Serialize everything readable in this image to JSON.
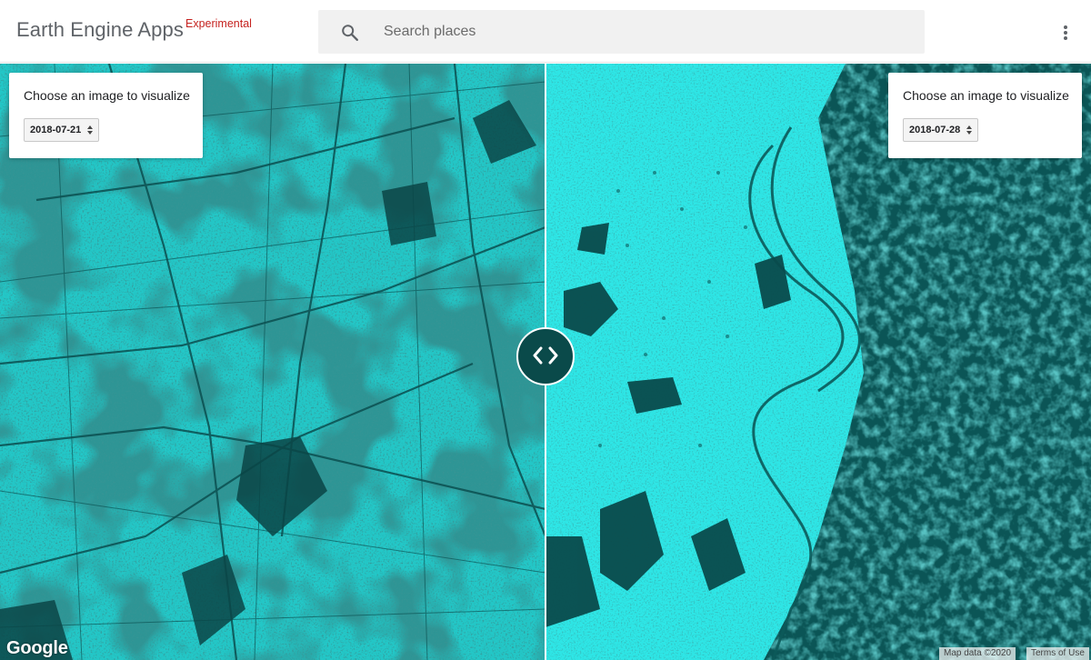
{
  "header": {
    "app_title": "Earth Engine Apps",
    "badge": "Experimental",
    "search_placeholder": "Search places",
    "search_value": ""
  },
  "panels": {
    "left": {
      "title": "Choose an image to visualize",
      "selected_date": "2018-07-21"
    },
    "right": {
      "title": "Choose an image to visualize",
      "selected_date": "2018-07-28"
    }
  },
  "map": {
    "left_image_date": "2018-07-21",
    "right_image_date": "2018-07-28",
    "colors": {
      "water_dark": "#0a4a4a",
      "land_bright": "#1fe0e0",
      "accent_badge": "#c5221f"
    }
  },
  "footer": {
    "logo_text": "Google",
    "map_data": "Map data ©2020",
    "terms": "Terms of Use"
  },
  "icons": [
    "search-icon",
    "more-vert-icon",
    "split-handle-icon",
    "spinner-arrows-icon"
  ]
}
